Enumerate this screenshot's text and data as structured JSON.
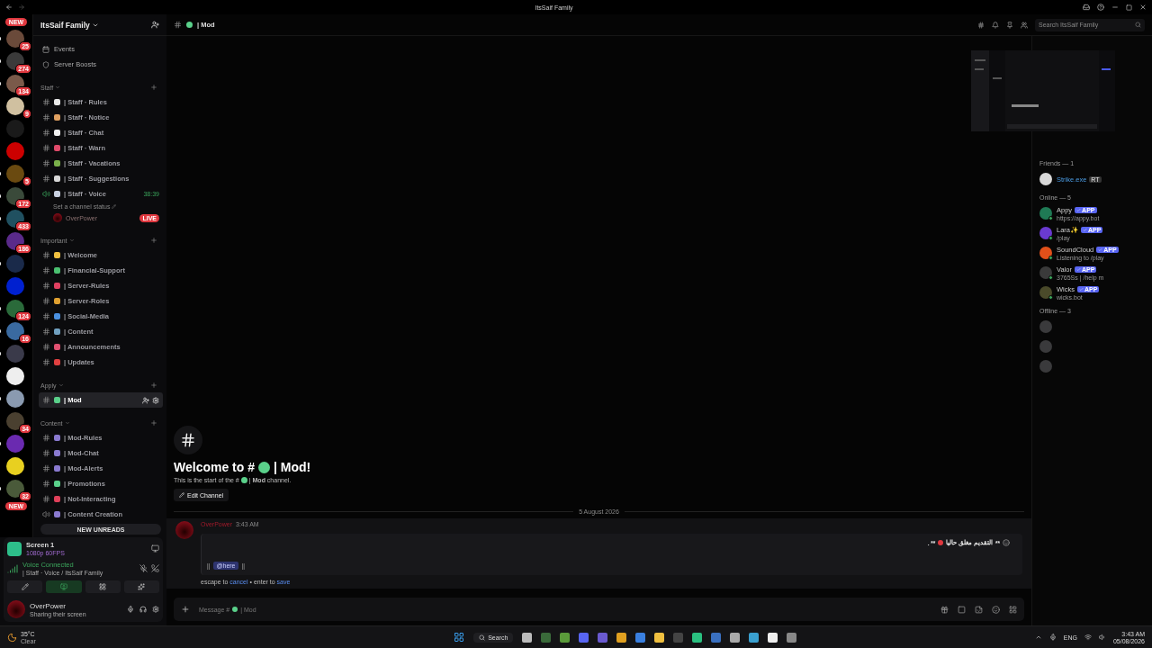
{
  "window": {
    "title": "ItsSaif Family"
  },
  "servers": {
    "new_top": "NEW",
    "new_bottom": "NEW",
    "items": [
      {
        "badge": "25",
        "unread": true
      },
      {
        "badge": "274",
        "unread": true
      },
      {
        "badge": "134",
        "unread": true
      },
      {
        "badge": "9",
        "unread": false
      },
      {
        "unread": false
      },
      {
        "unread": false
      },
      {
        "badge": "5",
        "unread": true
      },
      {
        "badge": "172",
        "unread": true
      },
      {
        "badge": "433",
        "unread": true
      },
      {
        "badge": "186",
        "unread": false
      },
      {
        "unread": true
      },
      {
        "unread": false
      },
      {
        "badge": "124",
        "unread": true
      },
      {
        "badge": "16",
        "unread": true
      },
      {
        "unread": true
      },
      {
        "unread": false
      },
      {
        "unread": true
      },
      {
        "badge": "34",
        "unread": false
      },
      {
        "unread": true
      },
      {
        "unread": false
      },
      {
        "badge": "32",
        "unread": true
      }
    ]
  },
  "sidebar": {
    "server_name": "ItsSaif Family",
    "links": [
      {
        "label": "Events",
        "kind": "events"
      },
      {
        "label": "Server Boosts",
        "kind": "boost"
      }
    ],
    "categories": [
      {
        "name": "Staff",
        "channels": [
          {
            "name": "| Staff · Rules",
            "kind": "text",
            "color": "#e8e8e8",
            "selected": false
          },
          {
            "name": "| Staff · Notice",
            "kind": "text",
            "color": "#e0a060",
            "selected": false
          },
          {
            "name": "| Staff · Chat",
            "kind": "text",
            "color": "#f0f0f0",
            "selected": false
          },
          {
            "name": "| Staff · Warn",
            "kind": "text",
            "color": "#e04a6a",
            "selected": false
          },
          {
            "name": "| Staff · Vacations",
            "kind": "text",
            "color": "#7ab04a",
            "selected": false
          },
          {
            "name": "| Staff · Suggestions",
            "kind": "text",
            "color": "#d8d8d8",
            "selected": false
          },
          {
            "name": "| Staff · Voice",
            "kind": "voice",
            "color": "#c8d0e0",
            "selected": false,
            "timer": "38:39",
            "status": "Set a channel status",
            "members": [
              {
                "name": "OverPower",
                "live": true,
                "badge": "LIVE"
              }
            ]
          }
        ]
      },
      {
        "name": "Important",
        "channels": [
          {
            "name": "| Welcome",
            "kind": "text",
            "color": "#f0c040",
            "selected": false
          },
          {
            "name": "| Financial-Support",
            "kind": "text",
            "color": "#4ac070",
            "selected": false
          },
          {
            "name": "| Server-Rules",
            "kind": "text",
            "color": "#e04060",
            "selected": false
          },
          {
            "name": "| Server-Roles",
            "kind": "text",
            "color": "#e0a030",
            "selected": false
          },
          {
            "name": "| Social-Media",
            "kind": "text",
            "color": "#4a90e0",
            "selected": false
          },
          {
            "name": "| Content",
            "kind": "text",
            "color": "#70a0c0",
            "selected": false
          },
          {
            "name": "| Announcements",
            "kind": "text",
            "color": "#e05070",
            "selected": false
          },
          {
            "name": "| Updates",
            "kind": "text",
            "color": "#e04040",
            "selected": false
          }
        ]
      },
      {
        "name": "Apply",
        "channels": [
          {
            "name": "| Mod",
            "kind": "text",
            "color": "#5ad08a",
            "selected": true
          }
        ]
      },
      {
        "name": "Content",
        "channels": [
          {
            "name": "| Mod-Rules",
            "kind": "text",
            "color": "#8a7ad0",
            "selected": false
          },
          {
            "name": "| Mod-Chat",
            "kind": "text",
            "color": "#8a7ad0",
            "selected": false
          },
          {
            "name": "| Mod-Alerts",
            "kind": "text",
            "color": "#8a7ad0",
            "selected": false
          },
          {
            "name": "| Promotions",
            "kind": "text",
            "color": "#5ad08a",
            "selected": false
          },
          {
            "name": "| Not-Interacting",
            "kind": "text",
            "color": "#e0405a",
            "selected": false
          },
          {
            "name": "| Content Creation",
            "kind": "voice",
            "color": "#8a7ad0",
            "selected": false
          }
        ]
      }
    ],
    "unreads_bar": "NEW UNREADS"
  },
  "stream": {
    "title": "Screen 1",
    "quality": "1080p 60FPS"
  },
  "voice": {
    "status": "Voice Connected",
    "channel": "| Staff · Voice / ItsSaif Family"
  },
  "user": {
    "name": "OverPower",
    "status": "Sharing their screen"
  },
  "header": {
    "channel": "| Mod",
    "search_placeholder": "Search ItsSaif Family"
  },
  "welcome": {
    "title_start": "Welcome to #",
    "title_end": "| Mod!",
    "subtitle_start": "This is the start of the #",
    "subtitle_end": "| **Mod** channel.",
    "button": "Edit Channel"
  },
  "date_divider": "5 August 2026",
  "message": {
    "author": "OverPower",
    "time": "3:43 AM",
    "edit_open": "**",
    "edit_text": "التقديم مغلق حاليا",
    "edit_close": ". **",
    "spoiler_open": "||",
    "mention": "@here",
    "spoiler_close": "||",
    "hint_start": "escape to",
    "hint_cancel": "cancel",
    "hint_middle": "• enter to",
    "hint_save": "save"
  },
  "composer": {
    "prompt_start": "Message #",
    "prompt_end": "| Mod"
  },
  "members": [
    {
      "title": "Friends — 1",
      "members": [
        {
          "name": "Strike.exe",
          "tag": "RT",
          "kind": "friend",
          "color": "#d8d8d8"
        }
      ]
    },
    {
      "title": "Online — 5",
      "members": [
        {
          "name": "Appy",
          "badge": "APP",
          "activity": "https://appy.bot",
          "kind": "bot",
          "color": "#1f7a55"
        },
        {
          "name": "Lara✨",
          "badge": "APP",
          "activity": "/play",
          "kind": "bot",
          "color": "#6a3ad0"
        },
        {
          "name": "SoundCloud",
          "badge": "APP",
          "activity": "Listening to /play",
          "kind": "bot",
          "color": "#e0501a"
        },
        {
          "name": "Valor",
          "badge": "APP",
          "activity": "3765Ss | /help m",
          "kind": "bot",
          "color": "#3a3a3a"
        },
        {
          "name": "Wicks",
          "badge": "APP",
          "activity": "wicks.bot",
          "kind": "bot",
          "color": "#4a4a2a"
        }
      ]
    },
    {
      "title": "Offline — 3",
      "members": [
        {
          "kind": "offline"
        },
        {
          "kind": "offline"
        },
        {
          "kind": "offline"
        }
      ]
    }
  ],
  "taskbar": {
    "temp": "35°C",
    "condition": "Clear",
    "search": "Search",
    "language": "ENG",
    "time": "3:43 AM",
    "date": "05/08/2026"
  }
}
